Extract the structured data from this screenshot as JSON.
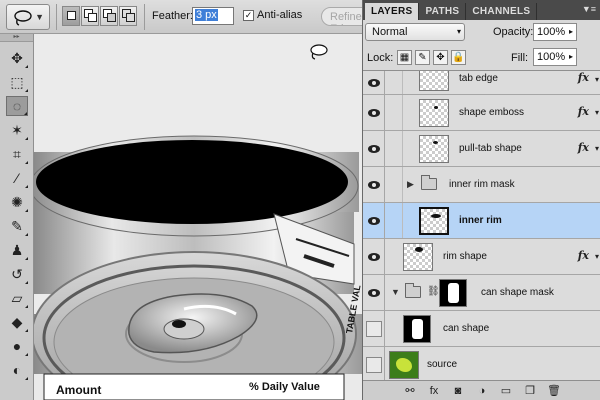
{
  "options_bar": {
    "feather_label": "Feather:",
    "feather_value": "3 px",
    "anti_alias_label": "Anti-alias",
    "anti_alias_checked": "✓",
    "refine_label": "Refine Edge..."
  },
  "tools": [
    {
      "name": "move-tool-icon",
      "glyph": "✥"
    },
    {
      "name": "marquee-tool-icon",
      "glyph": "⬚"
    },
    {
      "name": "lasso-tool-icon",
      "glyph": "◌"
    },
    {
      "name": "magic-wand-tool-icon",
      "glyph": "✶"
    },
    {
      "name": "crop-tool-icon",
      "glyph": "⌗"
    },
    {
      "name": "eyedropper-tool-icon",
      "glyph": "⁄"
    },
    {
      "name": "healing-brush-tool-icon",
      "glyph": "✺"
    },
    {
      "name": "brush-tool-icon",
      "glyph": "✎"
    },
    {
      "name": "clone-stamp-tool-icon",
      "glyph": "♟"
    },
    {
      "name": "history-brush-tool-icon",
      "glyph": "↺"
    },
    {
      "name": "eraser-tool-icon",
      "glyph": "▱"
    },
    {
      "name": "paint-bucket-tool-icon",
      "glyph": "◆"
    },
    {
      "name": "blur-tool-icon",
      "glyph": "●"
    },
    {
      "name": "dodge-tool-icon",
      "glyph": "◐"
    }
  ],
  "canvas": {
    "label_amount": "Amount",
    "label_daily_value": "% Daily Value",
    "side_text": "TABLE VAL"
  },
  "panel": {
    "tabs": [
      "LAYERS",
      "PATHS",
      "CHANNELS"
    ],
    "blend_mode": "Normal",
    "opacity_label": "Opacity:",
    "opacity_value": "100%",
    "lock_label": "Lock:",
    "fill_label": "Fill:",
    "fill_value": "100%"
  },
  "layers": [
    {
      "name": "tab edge",
      "fx": "fx"
    },
    {
      "name": "shape emboss",
      "fx": "fx"
    },
    {
      "name": "pull-tab shape",
      "fx": "fx"
    },
    {
      "name": "inner rim mask"
    },
    {
      "name": "inner rim"
    },
    {
      "name": "rim shape",
      "fx": "fx"
    },
    {
      "name": "can shape mask"
    },
    {
      "name": "can shape"
    },
    {
      "name": "source"
    }
  ],
  "footer_icons": [
    "link-layers-icon",
    "add-style-icon",
    "add-mask-icon",
    "adjustment-layer-icon",
    "new-group-icon",
    "new-layer-icon",
    "delete-layer-icon"
  ],
  "footer_glyphs": [
    "⚯",
    "fx",
    "◙",
    "◑",
    "▭",
    "❐",
    "🗑"
  ]
}
